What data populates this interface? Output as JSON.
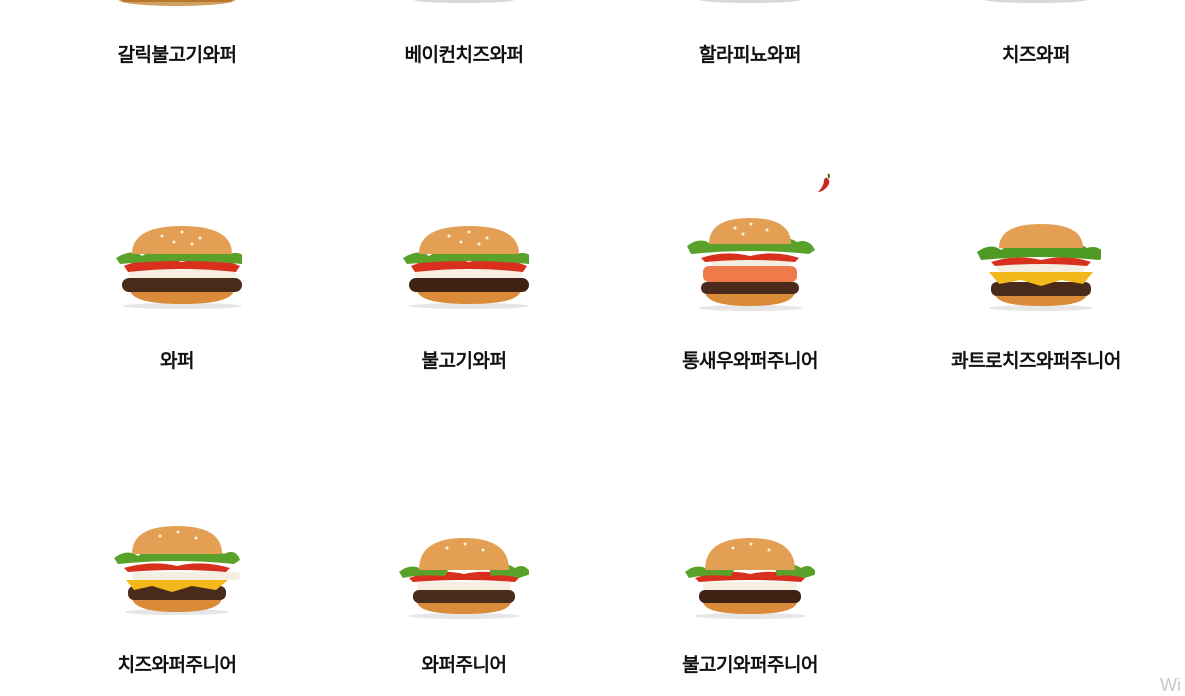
{
  "menu_items": [
    {
      "name": "갈릭불고기와퍼"
    },
    {
      "name": "베이컨치즈와퍼"
    },
    {
      "name": "할라피뇨와퍼"
    },
    {
      "name": "치즈와퍼"
    },
    {
      "name": "와퍼"
    },
    {
      "name": "불고기와퍼"
    },
    {
      "name": "통새우와퍼주니어"
    },
    {
      "name": "콰트로치즈와퍼주니어"
    },
    {
      "name": "치즈와퍼주니어"
    },
    {
      "name": "와퍼주니어"
    },
    {
      "name": "불고기와퍼주니어"
    }
  ],
  "badges": {
    "spicy_icon": "chili-pepper-icon"
  },
  "watermark": {
    "text": "Wi"
  },
  "colors": {
    "bun": "#d98b3a",
    "patty": "#4a2a1a",
    "lettuce": "#5aa12a",
    "tomato": "#d9301e",
    "cheese": "#f2b81c",
    "chili": "#c8261b"
  }
}
